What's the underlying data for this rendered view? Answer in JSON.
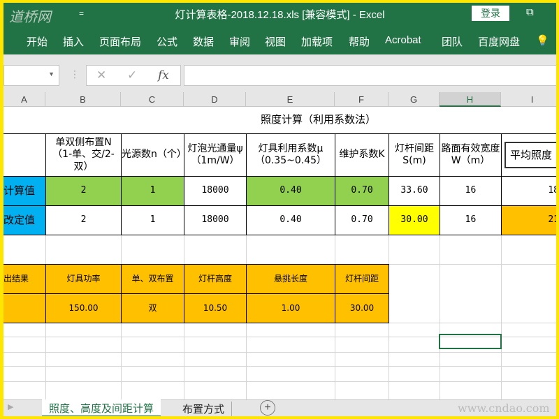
{
  "titlebar": {
    "logo": "道桥网",
    "qat": "=",
    "title": "灯计算表格-2018.12.18.xls  [兼容模式]  -  Excel",
    "login": "登录"
  },
  "ribbon": [
    "开始",
    "插入",
    "页面布局",
    "公式",
    "数据",
    "审阅",
    "视图",
    "加载项",
    "帮助",
    "Acrobat",
    "团队",
    "百度网盘"
  ],
  "formula_bar": {
    "fx": "fx",
    "cancel": "✕",
    "confirm": "✓",
    "value": ""
  },
  "columns": [
    "A",
    "B",
    "C",
    "D",
    "E",
    "F",
    "G",
    "H",
    "I"
  ],
  "sheet": {
    "title": "照度计算（利用系数法）",
    "headers": [
      "单双侧布置N（1-单、交/2-双）",
      "光源数n（个）",
      "灯泡光通量ψ（1m/W）",
      "灯具利用系数μ（0.35~0.45）",
      "维护系数K",
      "灯杆间距S(m)",
      "路面有效宽度W（m）",
      "平均照度"
    ],
    "row_calc": {
      "label": "计算值",
      "values": [
        "2",
        "1",
        "18000",
        "0.40",
        "0.70",
        "33.60",
        "16",
        "18"
      ]
    },
    "row_set": {
      "label": "改定值",
      "values": [
        "2",
        "1",
        "18000",
        "0.40",
        "0.70",
        "30.00",
        "16",
        "21"
      ]
    },
    "output_headers": [
      "出结果",
      "灯具功率",
      "单、双布置",
      "灯杆高度",
      "悬挑长度",
      "灯杆间距"
    ],
    "output_values": [
      "",
      "150.00",
      "双",
      "10.50",
      "1.00",
      "30.00"
    ]
  },
  "tabs": [
    "照度、高度及间距计算",
    "布置方式"
  ],
  "watermark": "www.cndao.com",
  "colors": {
    "excel_green": "#217346",
    "green": "#92d050",
    "blue": "#00b0f0",
    "yellow": "#ffff00",
    "orange": "#ffc000"
  }
}
